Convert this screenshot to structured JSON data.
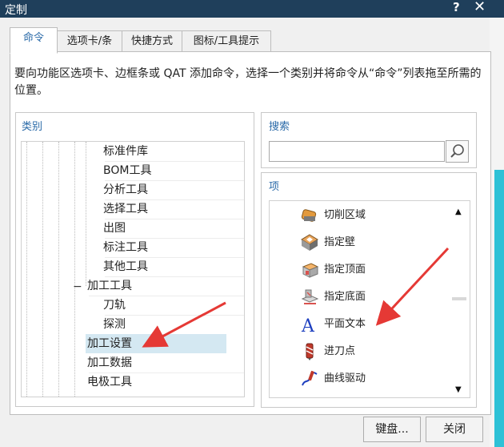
{
  "window": {
    "title": "定制",
    "help_label": "?",
    "close_label": "✕"
  },
  "tabs": [
    {
      "label": "命令",
      "active": true
    },
    {
      "label": "选项卡/条",
      "active": false
    },
    {
      "label": "快捷方式",
      "active": false
    },
    {
      "label": "图标/工具提示",
      "active": false
    }
  ],
  "description": "要向功能区选项卡、边框条或 QAT 添加命令，选择一个类别并将命令从“命令”列表拖至所需的位置。",
  "category": {
    "title": "类别",
    "items": [
      {
        "label": "标准件库"
      },
      {
        "label": "BOM工具"
      },
      {
        "label": "分析工具"
      },
      {
        "label": "选择工具"
      },
      {
        "label": "出图"
      },
      {
        "label": "标注工具"
      },
      {
        "label": "其他工具"
      },
      {
        "label": "加工工具",
        "expander": "−"
      },
      {
        "label": "刀轨"
      },
      {
        "label": "探测"
      },
      {
        "label": "加工设置",
        "selected": true
      },
      {
        "label": "加工数据"
      },
      {
        "label": "电极工具"
      },
      {
        "label": "..."
      }
    ]
  },
  "search": {
    "title": "搜索",
    "value": "",
    "icon": "magnifier-icon"
  },
  "items_panel": {
    "title": "项",
    "items": [
      {
        "label": "切削区域",
        "icon": "cut-area-icon"
      },
      {
        "label": "指定壁",
        "icon": "specify-wall-icon"
      },
      {
        "label": "指定顶面",
        "icon": "specify-top-face-icon"
      },
      {
        "label": "指定底面",
        "icon": "specify-bottom-face-icon"
      },
      {
        "label": "平面文本",
        "icon": "planar-text-icon"
      },
      {
        "label": "进刀点",
        "icon": "entry-point-icon"
      },
      {
        "label": "曲线驱动",
        "icon": "curve-drive-icon"
      }
    ]
  },
  "buttons": {
    "keyboard": "键盘...",
    "close": "关闭"
  },
  "colors": {
    "titlebar": "#1f3f5b",
    "accent": "#2a6aa8",
    "selection": "#d4e8f2",
    "arrow": "#e53935"
  }
}
